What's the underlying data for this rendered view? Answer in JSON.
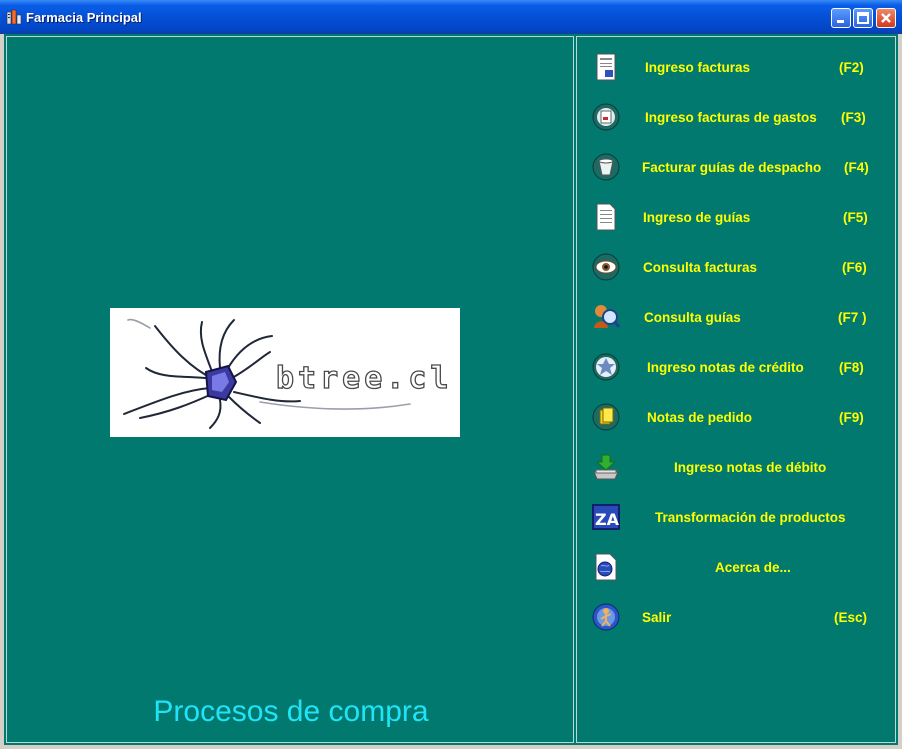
{
  "window": {
    "title": "Farmacia Principal",
    "icon": "app-building-icon",
    "controls": [
      "minimize-icon",
      "maximize-icon",
      "close-icon"
    ]
  },
  "logo": {
    "text": "btree.cl"
  },
  "footer": {
    "title": "Procesos de compra"
  },
  "colors": {
    "background": "#01796f",
    "menu_text": "#ffff00",
    "footer_text": "#1fe4f8"
  },
  "menu": [
    {
      "label": "Ingreso facturas",
      "key": "(F2)",
      "icon": "invoice-document-icon"
    },
    {
      "label": "Ingreso facturas de gastos",
      "key": "(F3)",
      "icon": "expense-invoice-icon"
    },
    {
      "label": "Facturar guías de despacho",
      "key": "(F4)",
      "icon": "dispatch-bucket-icon"
    },
    {
      "label": "Ingreso de guías",
      "key": "(F5)",
      "icon": "guide-document-icon"
    },
    {
      "label": "Consulta facturas",
      "key": "(F6)",
      "icon": "eye-icon"
    },
    {
      "label": "Consulta guías",
      "key": "(F7 )",
      "icon": "magnifier-person-icon"
    },
    {
      "label": "Ingreso notas de crédito",
      "key": "(F8)",
      "icon": "credit-note-icon"
    },
    {
      "label": "Notas de pedido",
      "key": "(F9)",
      "icon": "order-notes-icon"
    },
    {
      "label": "Ingreso notas de débito",
      "key": "",
      "icon": "download-tray-icon"
    },
    {
      "label": "Transformación de productos",
      "key": "",
      "icon": "sort-za-icon"
    },
    {
      "label": "Acerca de...",
      "key": "",
      "icon": "globe-document-icon"
    },
    {
      "label": "Salir",
      "key": "(Esc)",
      "icon": "exit-globe-icon"
    }
  ]
}
